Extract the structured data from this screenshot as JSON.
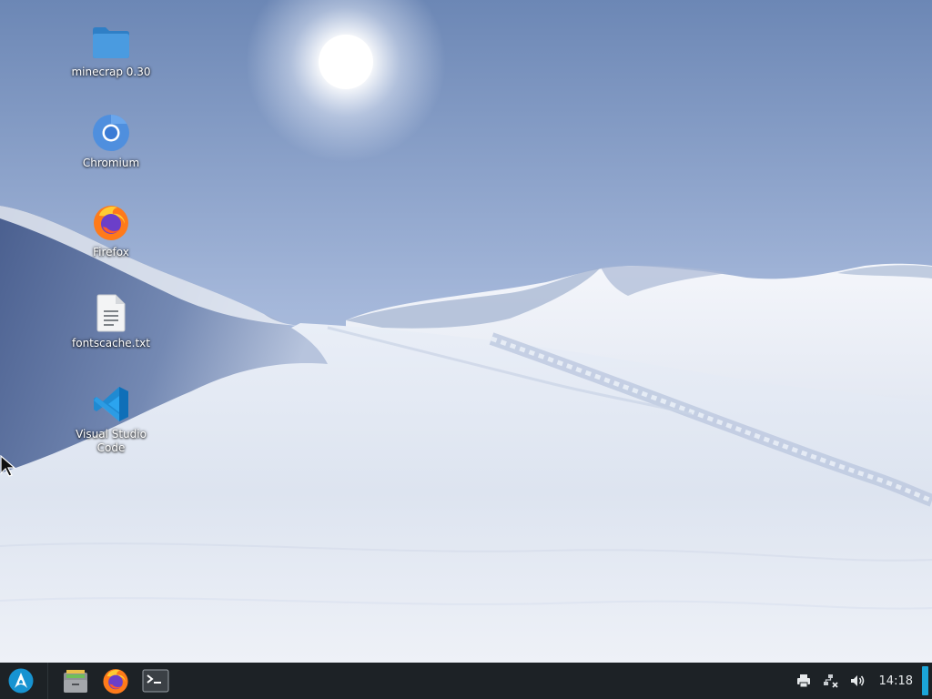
{
  "desktop": {
    "icons": [
      {
        "label": "minecrap 0.30",
        "icon": "folder-icon"
      },
      {
        "label": "Chromium",
        "icon": "chromium-icon"
      },
      {
        "label": "Firefox",
        "icon": "firefox-icon"
      },
      {
        "label": "fontscache.txt",
        "icon": "text-file-icon"
      },
      {
        "label": "Visual Studio Code",
        "icon": "vscode-icon"
      }
    ],
    "wallpaper": "snowy-mountain-sun"
  },
  "taskbar": {
    "launcher_icon": "app-launcher-icon",
    "tasks": [
      {
        "icon": "file-manager-icon"
      },
      {
        "icon": "firefox-icon"
      },
      {
        "icon": "terminal-icon"
      }
    ],
    "tray": [
      {
        "icon": "printer-icon"
      },
      {
        "icon": "network-disconnected-icon"
      },
      {
        "icon": "volume-icon"
      }
    ],
    "clock": "14:18"
  },
  "colors": {
    "taskbar_bg": "#1d2226",
    "accent": "#1ba5d8",
    "folder": "#3d8fd6",
    "sky_top": "#6f8ab6",
    "sky_bottom": "#c4d2ea"
  }
}
